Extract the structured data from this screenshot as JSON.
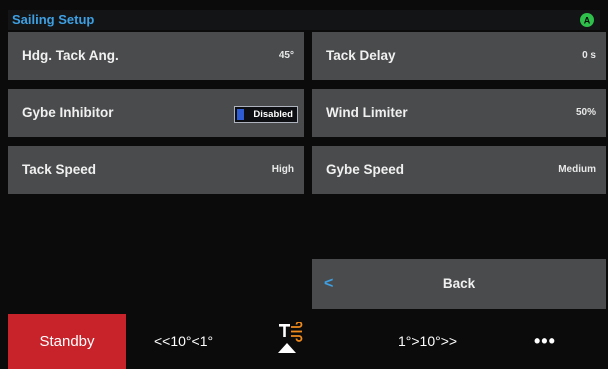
{
  "header": {
    "title": "Sailing Setup",
    "status_icon": "alert-a-icon",
    "status_icon_letter": "A",
    "accent_color": "#3ea0e3",
    "status_color": "#2fbf4b"
  },
  "settings": [
    {
      "label": "Hdg. Tack Ang.",
      "value": "45°"
    },
    {
      "label": "Tack Delay",
      "value": "0 s"
    },
    {
      "label": "Gybe Inhibitor",
      "value": "Disabled"
    },
    {
      "label": "Wind Limiter",
      "value": "50%"
    },
    {
      "label": "Tack Speed",
      "value": "High"
    },
    {
      "label": "Gybe Speed",
      "value": "Medium"
    }
  ],
  "back": {
    "label": "Back",
    "icon": "chevron-left-icon",
    "glyph": "<"
  },
  "bottom_bar": {
    "standby_label": "Standby",
    "standby_color": "#c8222b",
    "port_steer_label": "<<10°<1°",
    "tack_icon": "tack-gybe-icon",
    "starboard_steer_label": "1°>10°>>",
    "more_label": "•••"
  }
}
